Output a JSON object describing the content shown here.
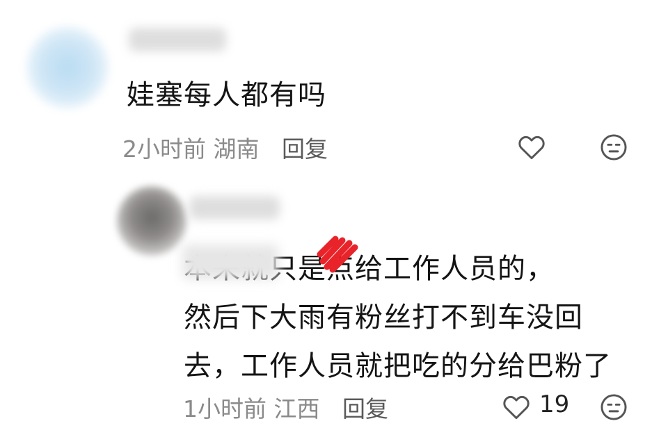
{
  "comments": [
    {
      "text": "娃塞每人都有吗",
      "time": "2小时前",
      "location": "湖南",
      "reply_label": "回复",
      "like_count": ""
    },
    {
      "text_lines": [
        "本来就只是点给工作人员的，",
        "然后下大雨有粉丝打不到车没回",
        "去，工作人员就把吃的分给巴粉了"
      ],
      "time": "1小时前",
      "location": "江西",
      "reply_label": "回复",
      "like_count": "19"
    }
  ],
  "icons": {
    "like": "heart-outline-icon",
    "dislike": "neutral-face-icon"
  },
  "colors": {
    "text": "#141414",
    "meta": "#8a8a8a",
    "icon": "#555555",
    "redaction": "#e8232a"
  }
}
